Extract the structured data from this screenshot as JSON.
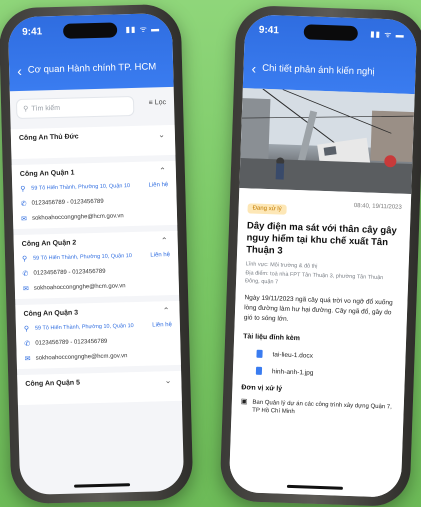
{
  "left": {
    "time": "9:41",
    "signal": "▮▮ ᯤ ▬",
    "nav_title": "Cơ quan Hành chính TP. HCM",
    "search_placeholder": "Tìm kiếm",
    "filter_label": "Lọc",
    "offices": [
      {
        "name": "Công An Thủ Đức",
        "expanded": false
      },
      {
        "name": "Công An Quận 1",
        "expanded": true,
        "address": "59 Tô Hiến Thành, Phường 10, Quận 10",
        "phone": "0123456789 - 0123456789",
        "email": "sokhoahoccongnghe@hcm.gov.vn",
        "contact": "Liên hệ"
      },
      {
        "name": "Công An Quận 2",
        "expanded": true,
        "address": "59 Tô Hiến Thành, Phường 10, Quận 10",
        "phone": "0123456789 - 0123456789",
        "email": "sokhoahoccongnghe@hcm.gov.vn",
        "contact": "Liên hệ"
      },
      {
        "name": "Công An Quận 3",
        "expanded": true,
        "address": "59 Tô Hiến Thành, Phường 10, Quận 10",
        "phone": "0123456789 - 0123456789",
        "email": "sokhoahoccongnghe@hcm.gov.vn",
        "contact": "Liên hệ"
      },
      {
        "name": "Công An Quận 5",
        "expanded": false
      }
    ]
  },
  "right": {
    "time": "9:41",
    "signal": "▮▮ ᯤ ▬",
    "nav_title": "Chi tiết phản ánh kiến nghị",
    "badge": "Đang xử lý",
    "date": "08:40, 19/11/2023",
    "title": "Dây điện ma sát với thân cây gây nguy hiểm tại khu chế xuất Tân Thuận 3",
    "field": "Lĩnh vực: Môi trường & đô thị",
    "location": "Địa điểm: toà nhà FPT Tân Thuận 3, phường Tân Thuận Đông, quận 7",
    "description": "Ngày 19/11/2023 ngã cây quá trời vo ngỡ đổ xuống lòng đường làm hư hại đường. Cây ngã đổ, gây do gió to sóng lớn.",
    "attachments_title": "Tài liệu đính kèm",
    "attachments": [
      "tai-lieu-1.docx",
      "hinh-anh-1.jpg"
    ],
    "unit_title": "Đơn vị xử lý",
    "unit": "Ban Quản lý dự án các công trình xây dựng Quận 7, TP Hồ Chí Minh",
    "colors": {
      "primary": "#2f6de0",
      "badge_bg": "#fde7b6",
      "badge_text": "#c27b00"
    }
  }
}
